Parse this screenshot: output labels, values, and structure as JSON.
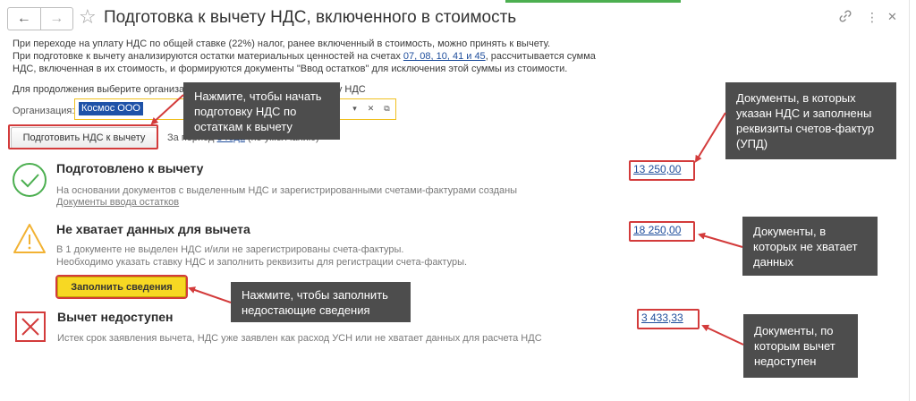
{
  "window": {
    "title": "Подготовка к вычету НДС, включенного в стоимость",
    "back_icon": "arrow-left-icon",
    "forward_icon": "arrow-right-icon",
    "favorite_icon": "star-icon",
    "link_icon": "link-icon",
    "more_icon": "more-vertical-icon",
    "close_icon": "close-icon"
  },
  "intro": {
    "line1": "При переходе на уплату НДС по общей ставке (22%) налог, ранее включенный в стоимость, можно принять к вычету.",
    "line2_before": "При подготовке к вычету анализируются остатки материальных ценностей на счетах ",
    "line2_accounts": "07, 08, 10, 41 и 45",
    "line2_after": ", рассчитывается сумма",
    "line3": "НДС, включенная в их стоимость, и формируются документы \"Ввод остатков\" для исключения этой суммы из стоимости.",
    "choose_org": "Для продолжения выберите организацию, применяющую общую ставку НДС"
  },
  "organization": {
    "label": "Организация:",
    "value": "Космос ООО",
    "dropdown_icon": "chevron-down-icon",
    "clear_icon": "clear-icon",
    "open_icon": "open-form-icon"
  },
  "actions": {
    "prepare_label": "Подготовить НДС к вычету",
    "period_prefix": "За период ",
    "period_link": "3 года",
    "period_suffix": " (по умолчанию)"
  },
  "sections": {
    "prepared": {
      "title": "Подготовлено к вычету",
      "desc": "На основании документов с выделенным НДС и зарегистрированными счетами-фактурами созданы",
      "link": "Документы ввода остатков",
      "amount": "13 250,00",
      "color": "#4caf50",
      "icon": "check-circle-icon"
    },
    "missing": {
      "title": "Не хватает данных для вычета",
      "desc1": "В 1 документе не выделен НДС и/или не зарегистрированы счета-фактуры.",
      "desc2": "Необходимо указать ставку НДС и заполнить реквизиты для регистрации счета-фактуры.",
      "fill_label": "Заполнить сведения",
      "amount": "18 250,00",
      "color": "#f2b233",
      "icon": "warning-triangle-icon"
    },
    "unavailable": {
      "title": "Вычет недоступен",
      "desc": "Истек срок заявления вычета, НДС уже заявлен как расход УСН или не хватает данных для расчета НДС",
      "amount": "3 433,33",
      "color": "#d33b3b",
      "icon": "cross-square-icon"
    }
  },
  "callouts": {
    "prepare": "Нажмите, чтобы начать\nподготовку НДС по\nостаткам к вычету",
    "docs_upd": "Документы, в которых\nуказан НДС и заполнены\nреквизиты счетов-фактур\n(УПД)",
    "docs_missing": "Документы, в\nкоторых не хватает\nданных",
    "fill": "Нажмите, чтобы заполнить\nнедостающие сведения",
    "docs_unavailable": "Документы, по\nкоторым вычет\nнедоступен"
  },
  "colors": {
    "accent_link": "#1f4e9c",
    "callout_bg": "#4d4d4d",
    "highlight_red": "#d33b3b",
    "field_focus": "#f0c020"
  }
}
